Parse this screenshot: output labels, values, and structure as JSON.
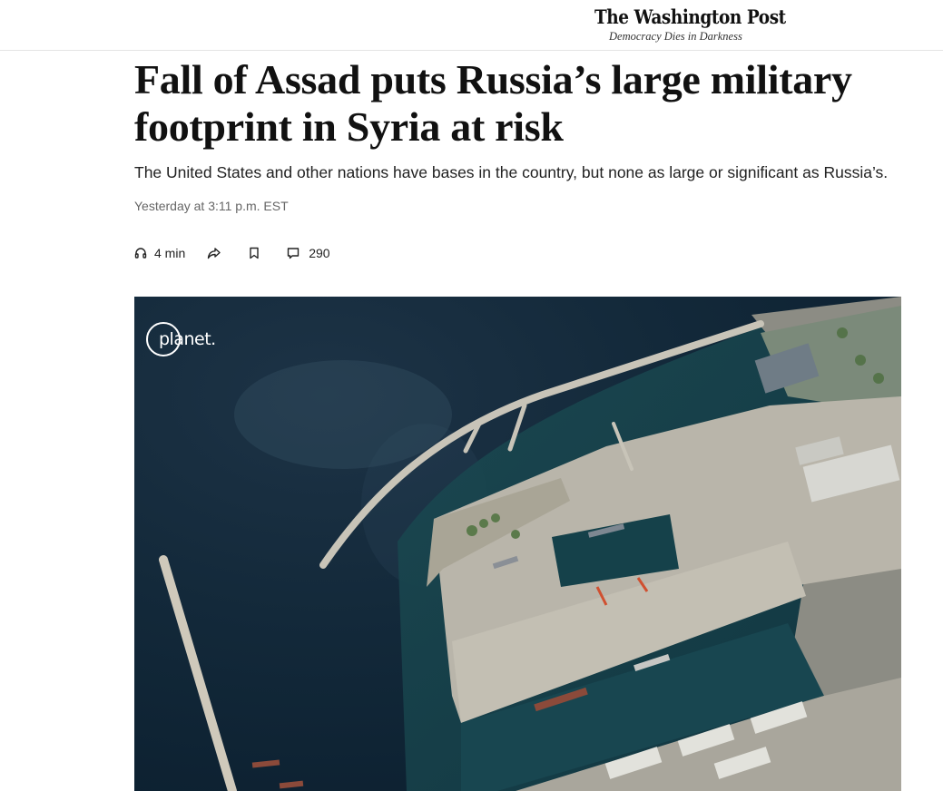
{
  "masthead": {
    "logo": "The Washington Post",
    "tagline": "Democracy Dies in Darkness"
  },
  "article": {
    "headline": "Fall of Assad puts Russia’s large military footprint in Syria at risk",
    "dek": "The United States and other nations have bases in the country, but none as large or significant as Russia’s.",
    "timestamp": "Yesterday at 3:11 p.m. EST"
  },
  "actions": {
    "listen": {
      "icon": "headphones-icon",
      "label": "4 min"
    },
    "share": {
      "icon": "share-arrow-icon"
    },
    "save": {
      "icon": "bookmark-icon"
    },
    "comments": {
      "icon": "comment-icon",
      "count": "290"
    }
  },
  "photo": {
    "credit": "planet.",
    "description_icon": "satellite-image"
  },
  "colors": {
    "text": "#111111",
    "secondary": "#666666",
    "water": "#0f2333",
    "land": "#b9b5aa"
  }
}
